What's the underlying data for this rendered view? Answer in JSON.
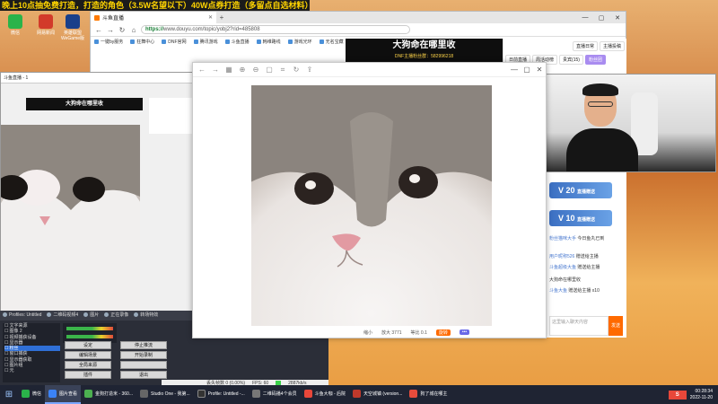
{
  "marquee": "晚上10点抽免费打造，打造的角色（3.5W名望以下）40W点券打造（多留点自选材料）",
  "desktop_icons": [
    "微信",
    "网易新闻",
    "英雄联盟WeGame版"
  ],
  "browser": {
    "tab_title": "斗鱼直播",
    "url_green": "https://",
    "url_rest": "www.douyu.com/topic/yobj2?rid=485808",
    "bookmarks": [
      "一键by服务",
      "狂舞中心",
      "DNF官网",
      "腾讯游戏",
      "斗鱼直播",
      "韩维路线",
      "游戏光环",
      "无名宝藏"
    ],
    "window_controls": [
      "—",
      "▢",
      "✕"
    ]
  },
  "stream_banner": {
    "title": "大狗命在哪里收",
    "subtitle": "DNF主播粉丝群：582996218"
  },
  "side_panel": {
    "tabs": [
      "日前直播",
      "周活动榜",
      "贵宾(15)",
      "粉丝团"
    ],
    "top_buttons": [
      "直播日常",
      "主播投稿"
    ],
    "gifts": [
      {
        "count": "20",
        "label": "直播赠送"
      },
      {
        "count": "10",
        "label": "直播赠送"
      }
    ],
    "chat": [
      {
        "user": "粉丝猫咪大手",
        "text": "今日鱼丸已到"
      },
      {
        "user": "用户昵称526",
        "text": "赠送给主播"
      },
      {
        "user": "斗鱼超级大鱼",
        "text": "赠送给主播"
      },
      {
        "user": "",
        "text": "大狗命在哪里收"
      },
      {
        "user": "斗鱼大鱼",
        "text": "赠送给主播 x10"
      }
    ],
    "input_placeholder": "这里输入聊天内容",
    "send_label": "发送"
  },
  "preview": {
    "header": "斗鱼直播 - 1",
    "banner": "大狗命在哪里收"
  },
  "viewer": {
    "toolbar_icons": [
      "arrow-left-icon",
      "arrow-right-icon",
      "grid-icon",
      "zoom-in-icon",
      "zoom-out-icon",
      "fit-icon",
      "crop-icon",
      "rotate-icon",
      "share-icon"
    ],
    "window_controls": [
      "—",
      "▢",
      "✕"
    ],
    "status": [
      "缩小",
      "放大 3771",
      "等比 0.1",
      "旋转"
    ]
  },
  "obs": {
    "top_items": [
      "Profiles: Untitled",
      "二维码视频4",
      "图片",
      "正在录像",
      "转场特效"
    ],
    "scenes": [
      "文字来源",
      "图像 2",
      "视频捕获设备",
      "显示器",
      "粉丝",
      "窗口捕获",
      "显示器获取",
      "图片组",
      "元"
    ],
    "selected_scene": "粉丝",
    "buttons": [
      "设定",
      "停止推流",
      "编辑场景",
      "开始录制",
      "全局来源",
      "",
      "插件",
      "退出"
    ],
    "status": [
      "丢失帧数 0 (0.00%)",
      "FPS: 60",
      "2887kb/s"
    ]
  },
  "taskbar": {
    "items": [
      "微信",
      "图片查看",
      "金狗打造米 - 360...",
      "Studio One - 我第...",
      "Profile: Untitled -...",
      "二维码播4个会员",
      "斗鱼大咖 - 后院",
      "天空城镇 (version...",
      "狗了城在哪主"
    ],
    "active_index": 1,
    "time": "00:28:34",
    "date": "2022-11-20",
    "ime": "S"
  },
  "colors": {
    "accent_orange": "#ff6a00",
    "obs_bg": "#2b2e38",
    "taskbar_bg": "#1f2433"
  }
}
